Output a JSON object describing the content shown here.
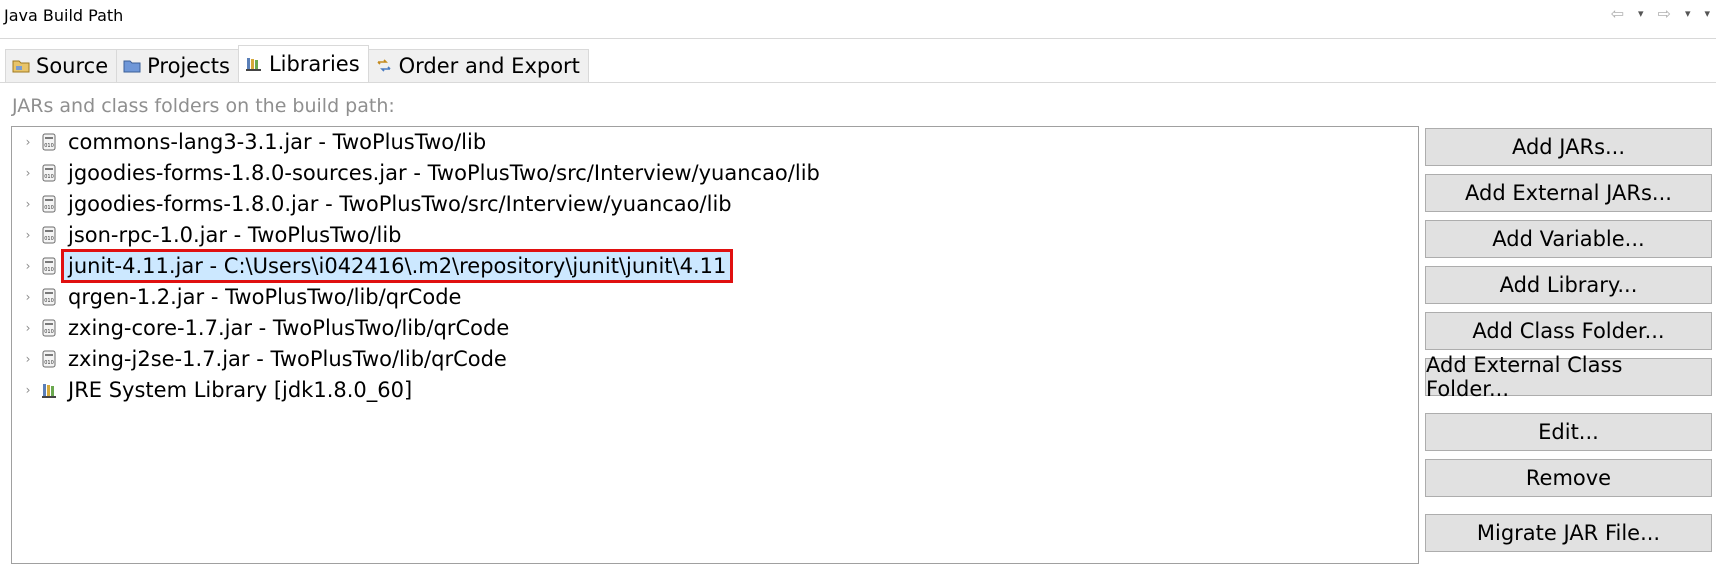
{
  "window": {
    "title": "Java Build Path"
  },
  "nav": {
    "back": "⇦",
    "forward": "⇨",
    "menu": "▾"
  },
  "tabs": [
    {
      "label": "Source",
      "icon": "source-folder-icon",
      "active": false
    },
    {
      "label": "Projects",
      "icon": "projects-icon",
      "active": false
    },
    {
      "label": "Libraries",
      "icon": "libraries-icon",
      "active": true
    },
    {
      "label": "Order and Export",
      "icon": "order-export-icon",
      "active": false
    }
  ],
  "caption": "JARs and class folders on the build path:",
  "libraries": [
    {
      "label": "commons-lang3-3.1.jar - TwoPlusTwo/lib",
      "icon": "jar-icon"
    },
    {
      "label": "jgoodies-forms-1.8.0-sources.jar - TwoPlusTwo/src/Interview/yuancao/lib",
      "icon": "jar-icon"
    },
    {
      "label": "jgoodies-forms-1.8.0.jar - TwoPlusTwo/src/Interview/yuancao/lib",
      "icon": "jar-icon"
    },
    {
      "label": "json-rpc-1.0.jar - TwoPlusTwo/lib",
      "icon": "jar-icon"
    },
    {
      "label": "junit-4.11.jar - C:\\Users\\i042416\\.m2\\repository\\junit\\junit\\4.11",
      "icon": "jar-icon",
      "selected": true
    },
    {
      "label": "qrgen-1.2.jar - TwoPlusTwo/lib/qrCode",
      "icon": "jar-icon"
    },
    {
      "label": "zxing-core-1.7.jar - TwoPlusTwo/lib/qrCode",
      "icon": "jar-icon"
    },
    {
      "label": "zxing-j2se-1.7.jar - TwoPlusTwo/lib/qrCode",
      "icon": "jar-icon"
    },
    {
      "label": "JRE System Library [jdk1.8.0_60]",
      "icon": "library-icon"
    }
  ],
  "buttons": {
    "add_jars": "Add JARs...",
    "add_external_jars": "Add External JARs...",
    "add_variable": "Add Variable...",
    "add_library": "Add Library...",
    "add_class_folder": "Add Class Folder...",
    "add_external_class_folder": "Add External Class Folder...",
    "edit": "Edit...",
    "remove": "Remove",
    "migrate_jar": "Migrate JAR File..."
  },
  "colors": {
    "selection": "#cce8ff",
    "highlight_box": "#e01010"
  }
}
